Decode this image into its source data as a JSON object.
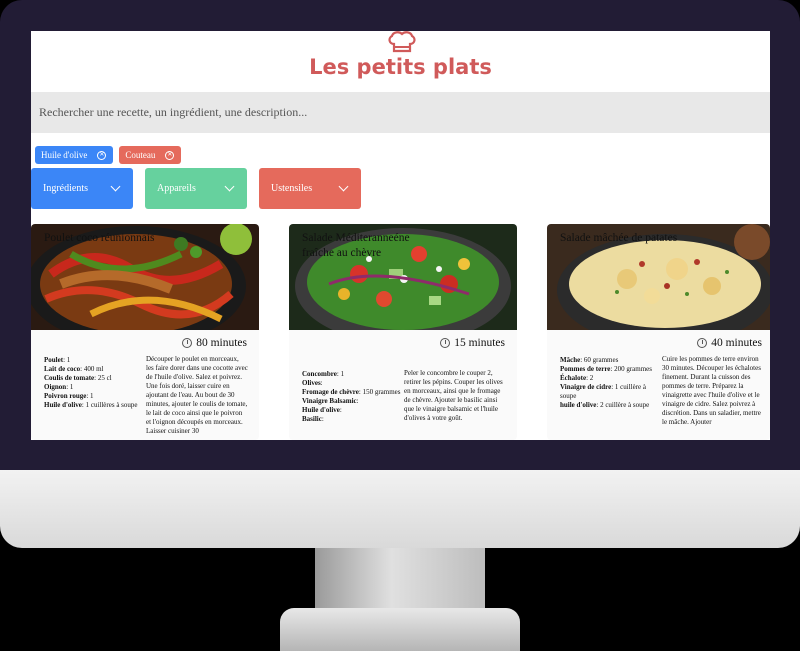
{
  "brand": {
    "title": "Les petits plats",
    "accent": "#d05a5a"
  },
  "search": {
    "placeholder": "Rechercher une recette, un ingrédient, une description..."
  },
  "tags": [
    {
      "label": "Huile d'olive",
      "color": "#3b86f7"
    },
    {
      "label": "Couteau",
      "color": "#e56a5c"
    }
  ],
  "filters": [
    {
      "label": "Ingrédients",
      "color": "#3b86f7"
    },
    {
      "label": "Appareils",
      "color": "#66d19e"
    },
    {
      "label": "Ustensiles",
      "color": "#e56a5c"
    }
  ],
  "recipes": [
    {
      "name": "Poulet coco réunionnais",
      "time": "80 minutes",
      "ingredients": [
        {
          "name": "Poulet",
          "qty": ": 1"
        },
        {
          "name": "Lait de coco",
          "qty": ": 400 ml"
        },
        {
          "name": "Coulis de tomate",
          "qty": ": 25 cl"
        },
        {
          "name": "Oignon",
          "qty": ": 1"
        },
        {
          "name": "Poivron rouge",
          "qty": ": 1"
        },
        {
          "name": "Huile d'olive",
          "qty": ": 1 cuillères à soupe"
        }
      ],
      "description": "Découper le poulet en morceaux, les faire dorer dans une cocotte avec de l'huile d'olive. Salez et poivrez. Une fois doré, laisser cuire en ajoutant de l'eau. Au bout de 30 minutes, ajouter le coulis de tomate, le lait de coco ainsi que le poivron et l'oignon découpés en morceaux. Laisser cuisiner 30"
    },
    {
      "name": "Salade Méditeranneéne fraîche au chèvre",
      "time": "15 minutes",
      "ingredients": [
        {
          "name": "Concombre",
          "qty": ": 1"
        },
        {
          "name": "Olives",
          "qty": ":"
        },
        {
          "name": "Fromage de chèvre",
          "qty": ": 150 grammes"
        },
        {
          "name": "Vinaigre Balsamic",
          "qty": ":"
        },
        {
          "name": "Huile d'olive",
          "qty": ":"
        },
        {
          "name": "Basilic",
          "qty": ":"
        }
      ],
      "description": "Peler le concombre le couper 2, retirer les pépins. Couper les olives en morceaux, ainsi que le fromage de chèvre. Ajouter le basilic ainsi que le vinaigre balsamic et l'huile d'olives à votre goût."
    },
    {
      "name": "Salade mâchée de patates",
      "time": "40 minutes",
      "ingredients": [
        {
          "name": "Mâche",
          "qty": ": 60 grammes"
        },
        {
          "name": "Pommes de terre",
          "qty": ": 200 grammes"
        },
        {
          "name": "Échalote",
          "qty": ": 2"
        },
        {
          "name": "Vinaigre de cidre",
          "qty": ": 1 cuillère à soupe"
        },
        {
          "name": "huile d'olive",
          "qty": ": 2 cuillère à soupe"
        }
      ],
      "description": "Cuire les pommes de terre environ 30 minutes. Découper les échalotes finement. Durant la cuisson des pommes de terre. Préparez la vinaigrette avec l'huile d'olive et le vinaigre de cidre. Salez poivrez à discrétion. Dans un saladier, mettre le mâche. Ajouter"
    }
  ]
}
